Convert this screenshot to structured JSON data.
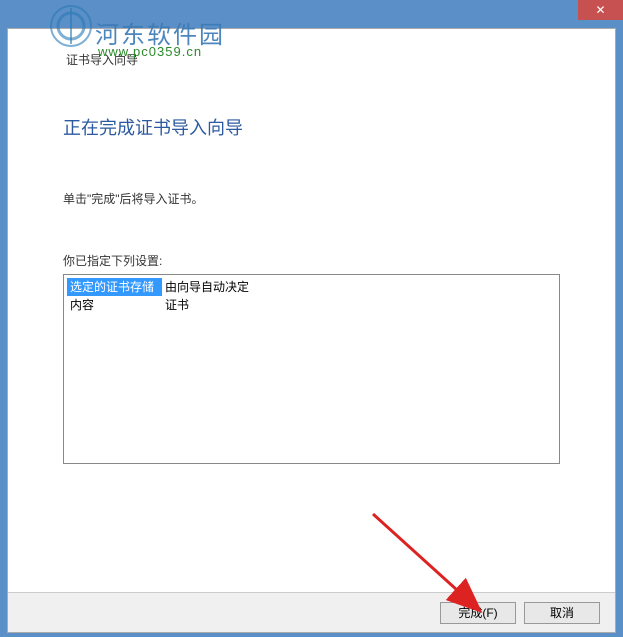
{
  "watermark": {
    "site_name": "河东软件园",
    "url": "www.pc0359.cn"
  },
  "dialog": {
    "title": "证书导入向导",
    "heading": "正在完成证书导入向导",
    "instruction": "单击\"完成\"后将导入证书。",
    "settings_label": "你已指定下列设置:",
    "rows": [
      {
        "key": "选定的证书存储",
        "value": "由向导自动决定"
      },
      {
        "key": "内容",
        "value": "证书"
      }
    ]
  },
  "buttons": {
    "finish": "完成(F)",
    "cancel": "取消"
  }
}
